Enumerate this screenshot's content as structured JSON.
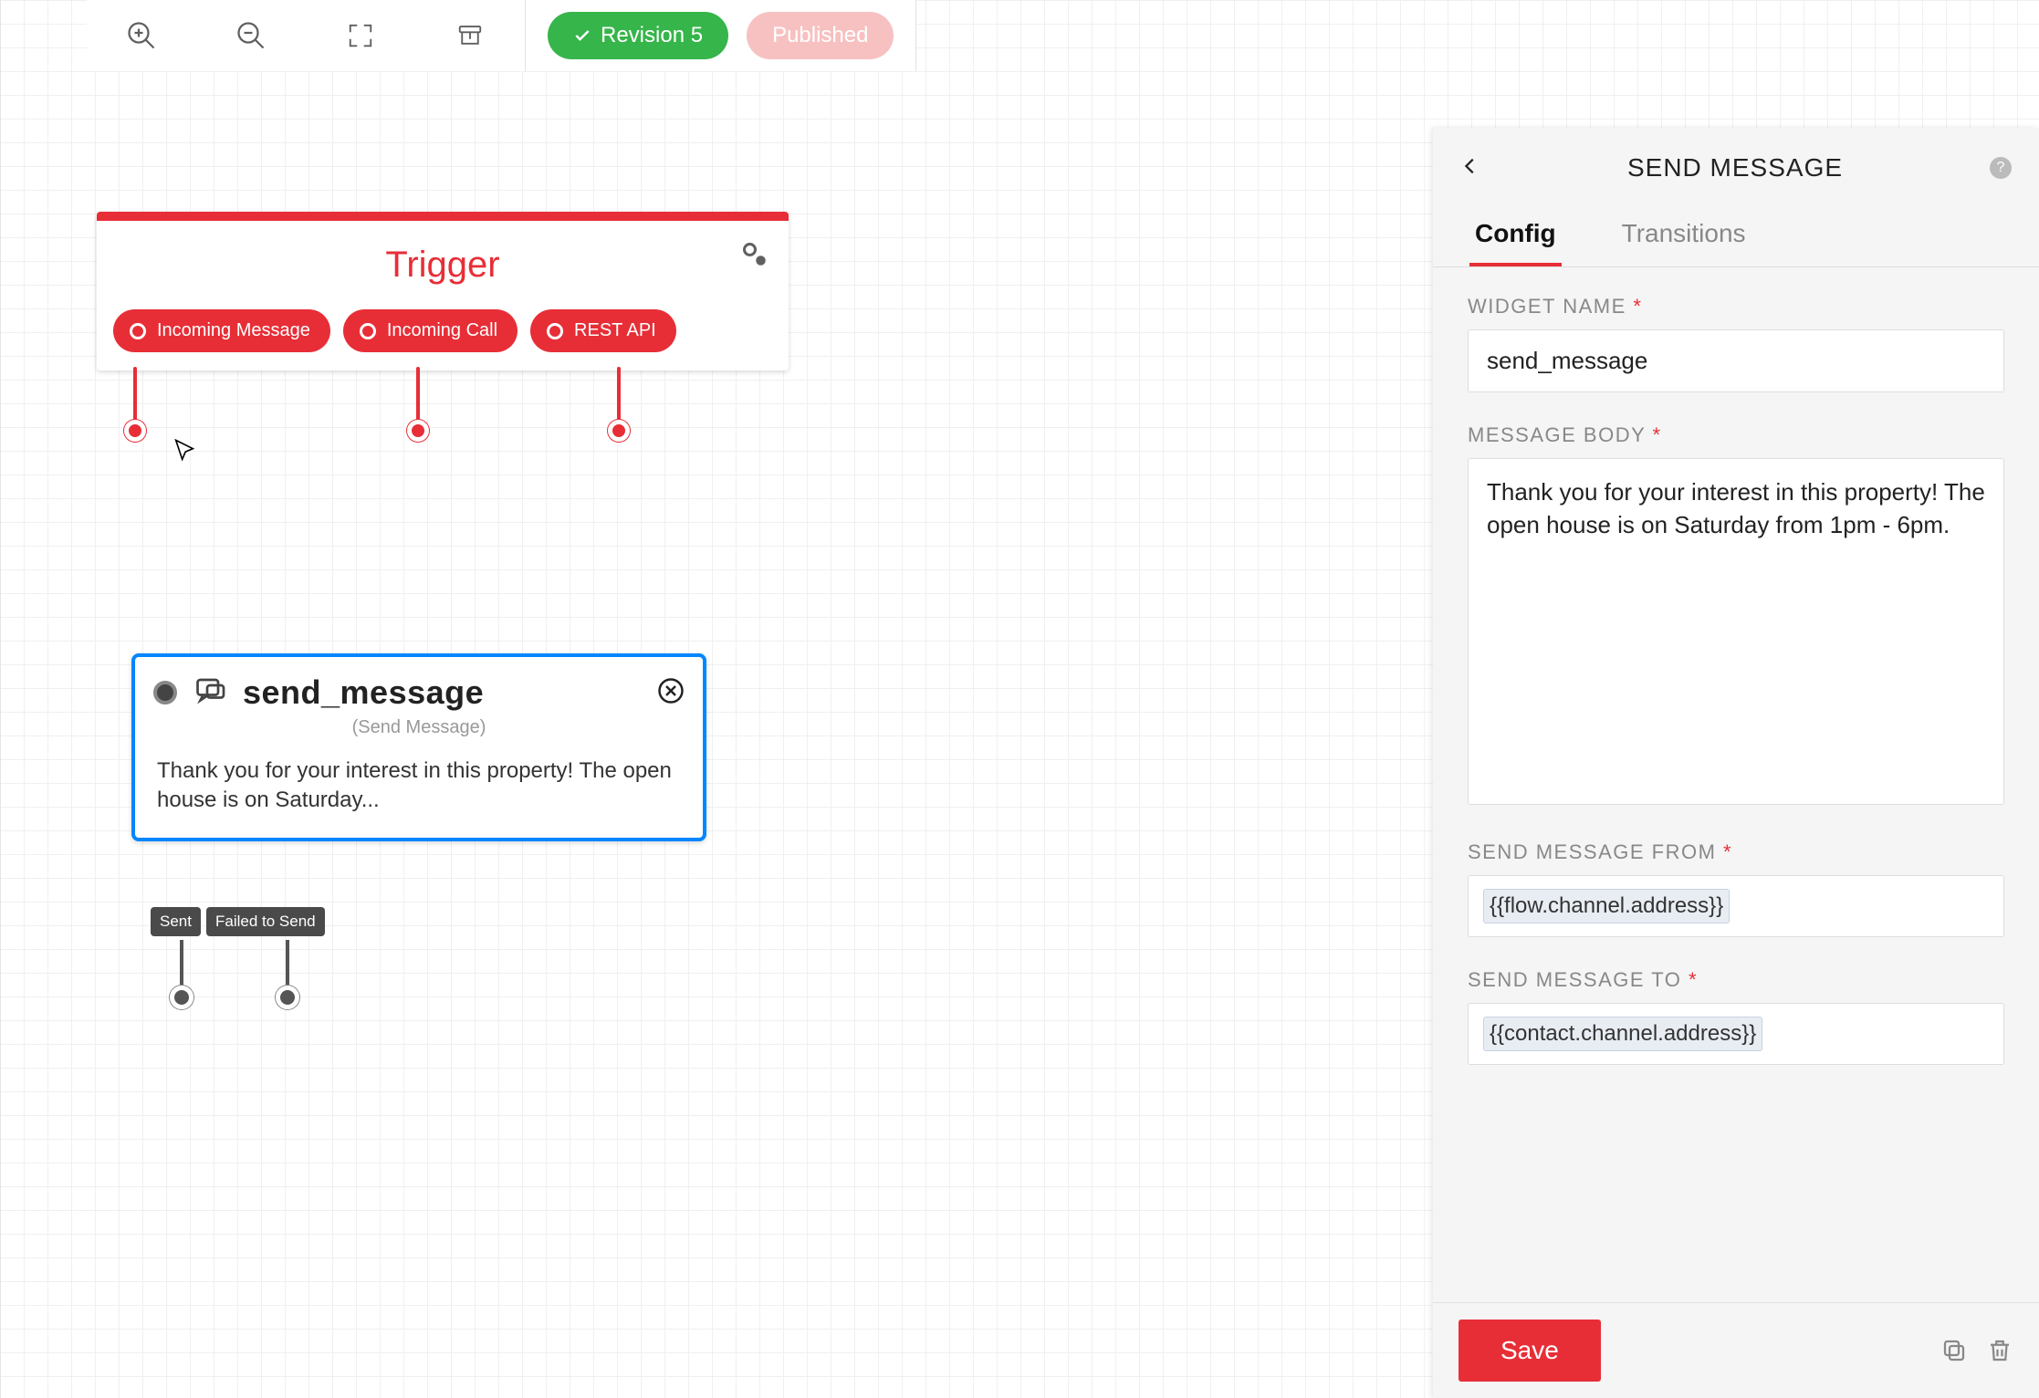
{
  "toolbar": {
    "revision_label": "Revision 5",
    "published_label": "Published"
  },
  "trigger": {
    "title": "Trigger",
    "pills": [
      "Incoming Message",
      "Incoming Call",
      "REST API"
    ]
  },
  "send_card": {
    "title": "send_message",
    "subtitle": "(Send Message)",
    "body_preview": "Thank you for your interest in this property! The open house is on Saturday...",
    "outputs": [
      "Sent",
      "Failed to Send"
    ]
  },
  "panel": {
    "title": "SEND MESSAGE",
    "tabs": {
      "config": "Config",
      "transitions": "Transitions"
    },
    "widget_name_label": "WIDGET NAME",
    "widget_name_value": "send_message",
    "message_body_label": "MESSAGE BODY",
    "message_body_value": "Thank you for your interest in this property! The open house is on Saturday from 1pm - 6pm.",
    "send_from_label": "SEND MESSAGE FROM",
    "send_from_value": "{{flow.channel.address}}",
    "send_to_label": "SEND MESSAGE TO",
    "send_to_value": "{{contact.channel.address}}",
    "save_label": "Save"
  }
}
